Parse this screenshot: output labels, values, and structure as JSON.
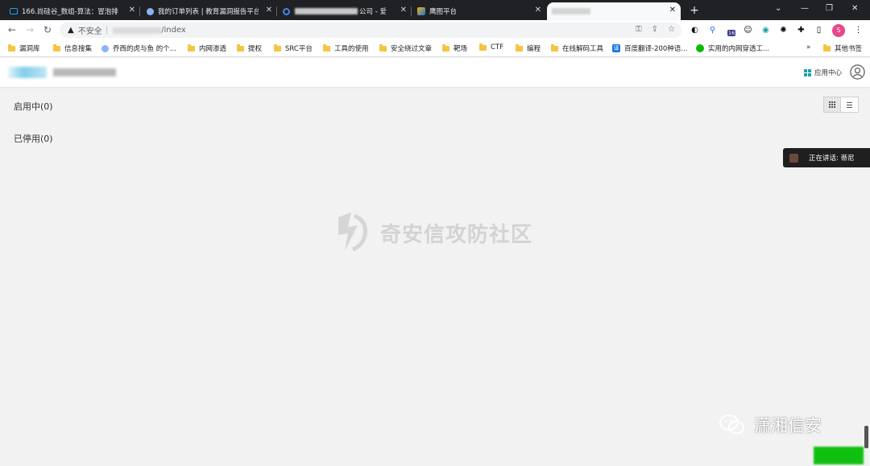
{
  "tabs": [
    {
      "title": "166.尚硅谷_数组-算法：冒泡排序",
      "icon": "tv-icon"
    },
    {
      "title": "我的订单列表 | 教育漏洞报告平台",
      "icon": "globe-icon"
    },
    {
      "title": "公司 - 爱",
      "icon": "google-icon"
    },
    {
      "title": "鹰图平台",
      "icon": "hawk-icon"
    },
    {
      "title": "",
      "icon": "blank-icon"
    }
  ],
  "omnibox": {
    "security": "不安全",
    "url": "/index"
  },
  "bookmarks": [
    "漏洞库",
    "信息搜集",
    "乔西的虎与鱼 的个...",
    "内网渗透",
    "提权",
    "SRC平台",
    "工具的使用",
    "安全绕过文章",
    "靶场",
    "CTF",
    "编程",
    "在线解码工具",
    "百度翻译-200种语...",
    "实用的内网穿透工..."
  ],
  "bookmarks_more": "»",
  "bookmarks_other": "其他书签",
  "extensions": {
    "badge_counter": "16",
    "profile_initial": "S"
  },
  "app": {
    "app_center": "应用中心"
  },
  "sections": {
    "enabled": "启用中(0)",
    "disabled": "已停用(0)"
  },
  "speaking": {
    "label": "正在讲话: 蒂尼"
  },
  "watermark": {
    "text": "奇安信攻防社区"
  },
  "footer": {
    "brand": "潇湘信安"
  },
  "colors": {
    "tab_bar": "#202124",
    "accent_teal": "#1aa3a3",
    "watermark": "#d3d3d3",
    "page_bg": "#f2f2f2"
  }
}
